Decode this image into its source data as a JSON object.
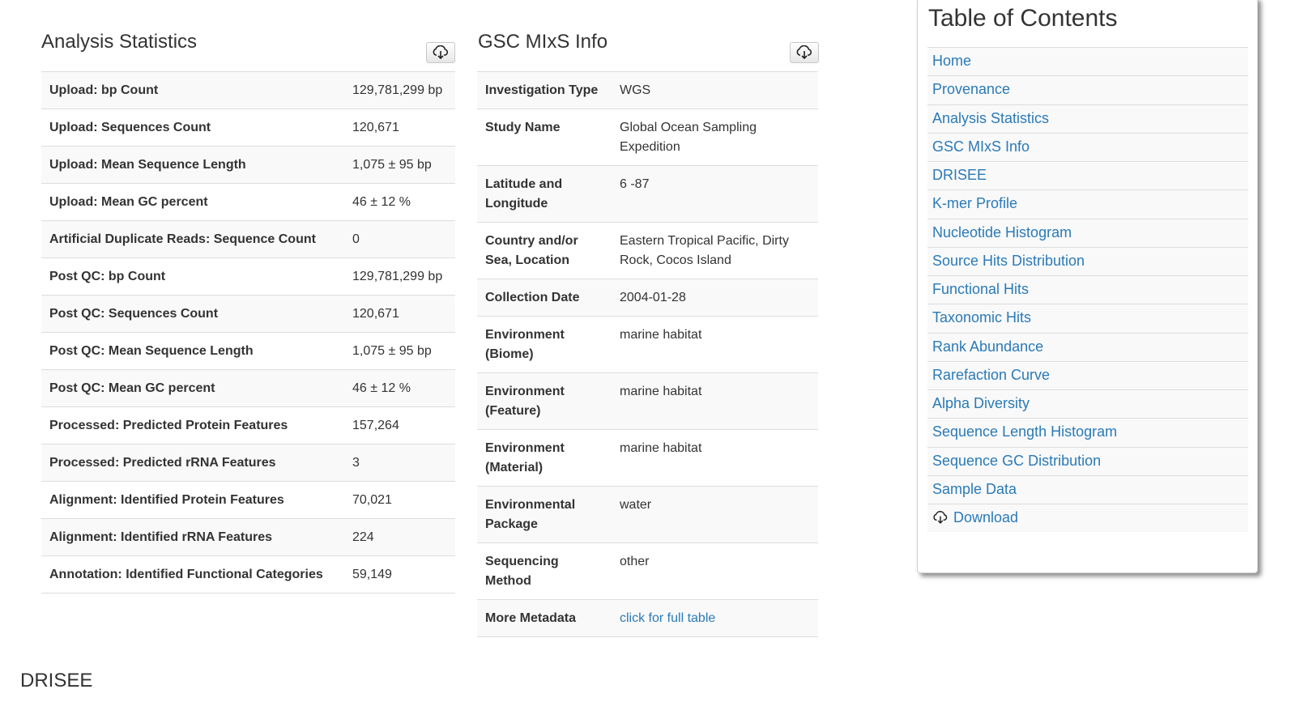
{
  "analysis_statistics": {
    "title": "Analysis Statistics",
    "rows": [
      {
        "label": "Upload: bp Count",
        "value": "129,781,299 bp"
      },
      {
        "label": "Upload: Sequences Count",
        "value": "120,671"
      },
      {
        "label": "Upload: Mean Sequence Length",
        "value": "1,075 ± 95 bp"
      },
      {
        "label": "Upload: Mean GC percent",
        "value": "46 ± 12 %"
      },
      {
        "label": "Artificial Duplicate Reads: Sequence Count",
        "value": "0"
      },
      {
        "label": "Post QC: bp Count",
        "value": "129,781,299 bp"
      },
      {
        "label": "Post QC: Sequences Count",
        "value": "120,671"
      },
      {
        "label": "Post QC: Mean Sequence Length",
        "value": "1,075 ± 95 bp"
      },
      {
        "label": "Post QC: Mean GC percent",
        "value": "46 ± 12 %"
      },
      {
        "label": "Processed: Predicted Protein Features",
        "value": "157,264"
      },
      {
        "label": "Processed: Predicted rRNA Features",
        "value": "3"
      },
      {
        "label": "Alignment: Identified Protein Features",
        "value": "70,021"
      },
      {
        "label": "Alignment: Identified rRNA Features",
        "value": "224"
      },
      {
        "label": "Annotation: Identified Functional Categories",
        "value": "59,149"
      }
    ]
  },
  "mixs_info": {
    "title": "GSC MIxS Info",
    "rows": [
      {
        "label": "Investigation Type",
        "value": "WGS"
      },
      {
        "label": "Study Name",
        "value": "Global Ocean Sampling Expedition"
      },
      {
        "label": "Latitude and Longitude",
        "value": "6 -87"
      },
      {
        "label": "Country and/or Sea, Location",
        "value": "Eastern Tropical Pacific, Dirty Rock, Cocos Island"
      },
      {
        "label": "Collection Date",
        "value": "2004-01-28"
      },
      {
        "label": "Environment (Biome)",
        "value": "marine habitat"
      },
      {
        "label": "Environment (Feature)",
        "value": "marine habitat"
      },
      {
        "label": "Environment (Material)",
        "value": "marine habitat"
      },
      {
        "label": "Environmental Package",
        "value": "water"
      },
      {
        "label": "Sequencing Method",
        "value": "other"
      },
      {
        "label": "More Metadata",
        "value": "click for full table",
        "is_link": true
      }
    ]
  },
  "toc": {
    "title": "Table of Contents",
    "items": [
      "Home",
      "Provenance",
      "Analysis Statistics",
      "GSC MIxS Info",
      "DRISEE",
      "K-mer Profile",
      "Nucleotide Histogram",
      "Source Hits Distribution",
      "Functional Hits",
      "Taxonomic Hits",
      "Rank Abundance",
      "Rarefaction Curve",
      "Alpha Diversity",
      "Sequence Length Histogram",
      "Sequence GC Distribution",
      "Sample Data"
    ],
    "download_label": "Download"
  },
  "drisee_section": {
    "title": "DRISEE"
  },
  "icons": {
    "download": "cloud-download-icon"
  },
  "colors": {
    "link": "#2a7ab8",
    "row_stripe": "#f9f9f9",
    "border": "#dddddd"
  }
}
